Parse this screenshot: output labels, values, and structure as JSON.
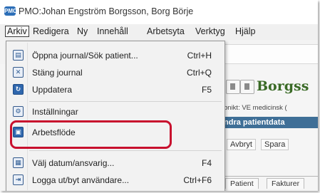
{
  "window": {
    "app_icon_text": "PMO",
    "title": "PMO:Johan Engström  Borgsson, Borg Börje"
  },
  "menubar": {
    "items": [
      {
        "label": "Arkiv"
      },
      {
        "label": "Redigera"
      },
      {
        "label": "Ny"
      },
      {
        "label": "Innehåll"
      },
      {
        "label": "Arbetsyta"
      },
      {
        "label": "Verktyg"
      },
      {
        "label": "Hjälp"
      }
    ]
  },
  "arkiv_menu": {
    "items": [
      {
        "label": "Öppna journal/Sök patient...",
        "shortcut": "Ctrl+H",
        "icon": "open-journal-icon"
      },
      {
        "label": "Stäng journal",
        "shortcut": "Ctrl+Q",
        "icon": "close-journal-icon"
      },
      {
        "label": "Uppdatera",
        "shortcut": "F5",
        "icon": "refresh-icon"
      },
      {
        "label": "Inställningar",
        "shortcut": "",
        "icon": "settings-icon"
      },
      {
        "label": "Arbetsflöde",
        "shortcut": "",
        "icon": "workflow-icon"
      },
      {
        "label": "Välj datum/ansvarig...",
        "shortcut": "F4",
        "icon": "calendar-icon"
      },
      {
        "label": "Logga ut/byt användare...",
        "shortcut": "Ctrl+F6",
        "icon": "logout-icon"
      }
    ],
    "highlighted_item": "Arbetsflöde",
    "highlight_color": "#c8102e"
  },
  "background": {
    "patient_name": "Borgss",
    "clinic_line": "bnikt: VE medicinsk (",
    "edit_banner": "ndra patientdata",
    "actions": [
      "Avbryt",
      "Spara"
    ],
    "tabs": [
      "Patient",
      "Fakturer"
    ]
  }
}
